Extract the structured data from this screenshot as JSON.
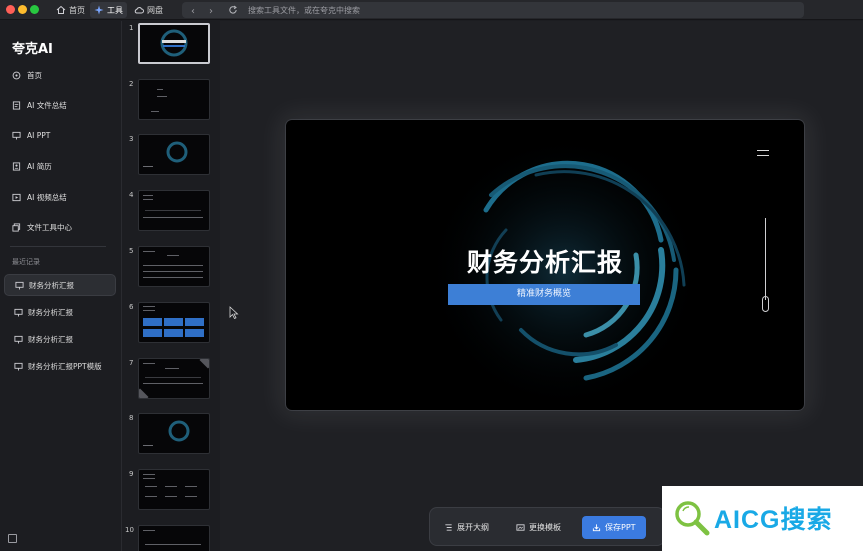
{
  "titlebar": {
    "tabs": [
      {
        "label": "首页",
        "icon": "home-icon"
      },
      {
        "label": "工具",
        "icon": "sparkle-icon"
      },
      {
        "label": "网盘",
        "icon": "cloud-icon"
      }
    ],
    "search_placeholder": "搜索工具文件，或在夸克中搜索"
  },
  "sidebar": {
    "brand": "夸克AI",
    "nav": [
      {
        "label": "首页",
        "icon": "home-icon"
      },
      {
        "label": "AI 文件总结",
        "icon": "document-icon"
      },
      {
        "label": "AI PPT",
        "icon": "presentation-icon"
      },
      {
        "label": "AI 简历",
        "icon": "resume-icon"
      },
      {
        "label": "AI 视频总结",
        "icon": "video-icon"
      },
      {
        "label": "文件工具中心",
        "icon": "toolbox-icon"
      }
    ],
    "recent_label": "最近记录",
    "recent": [
      {
        "label": "财务分析汇报",
        "active": true
      },
      {
        "label": "财务分析汇报",
        "active": false
      },
      {
        "label": "财务分析汇报",
        "active": false
      },
      {
        "label": "财务分析汇报PPT模版",
        "active": false
      }
    ]
  },
  "thumbnails": [
    {
      "number": "1"
    },
    {
      "number": "2"
    },
    {
      "number": "3"
    },
    {
      "number": "4"
    },
    {
      "number": "5"
    },
    {
      "number": "6"
    },
    {
      "number": "7"
    },
    {
      "number": "8"
    },
    {
      "number": "9"
    },
    {
      "number": "10"
    }
  ],
  "slide": {
    "title": "财务分析汇报",
    "subtitle": "精准财务概览"
  },
  "toolbar": {
    "outline_label": "展开大纲",
    "template_label": "更换模板",
    "save_label": "保存PPT"
  },
  "watermark": {
    "text": "AICG搜索"
  },
  "colors": {
    "accent": "#3b7be0",
    "slide_banner": "#3d7fd6",
    "watermark": "#19a9e6"
  }
}
